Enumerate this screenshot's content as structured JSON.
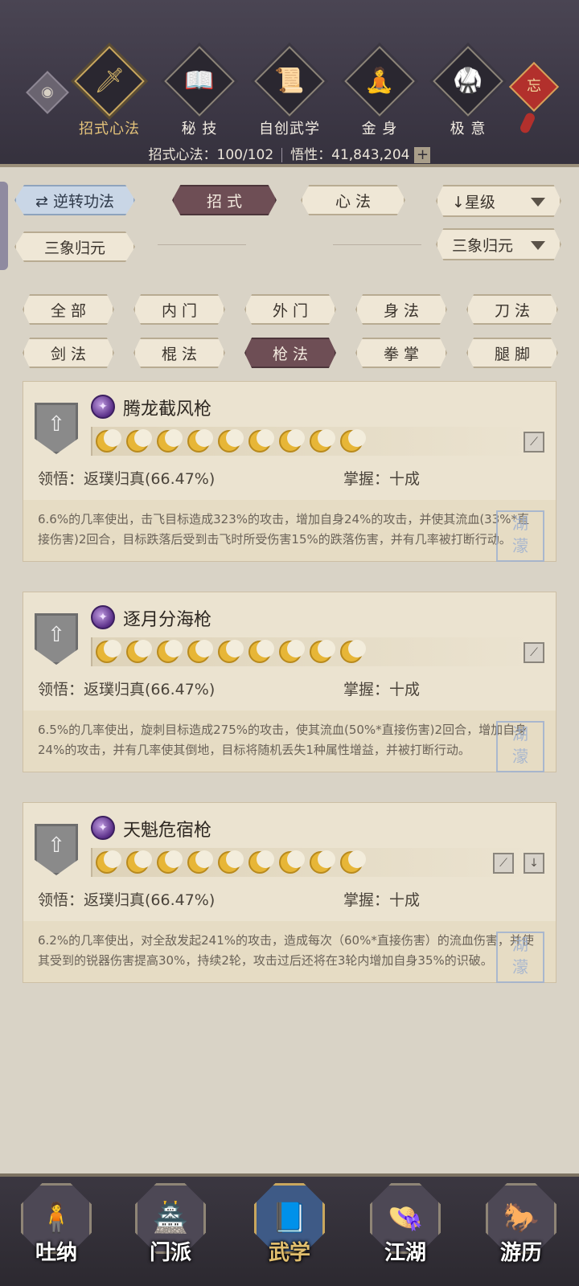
{
  "top_tabs": [
    {
      "label": "招式心法",
      "icon": "sword-icon",
      "glyph": "🗡"
    },
    {
      "label": "秘 技",
      "icon": "book-icon",
      "glyph": "📖"
    },
    {
      "label": "自创武学",
      "icon": "scroll-icon",
      "glyph": "📜"
    },
    {
      "label": "金 身",
      "icon": "meditation-icon",
      "glyph": "🧘"
    },
    {
      "label": "极 意",
      "icon": "martial-stance-icon",
      "glyph": "🥋"
    }
  ],
  "charm": {
    "label": "忘"
  },
  "stats": {
    "moves_label": "招式心法：100/102",
    "insight_label": "悟性：41,843,204",
    "plus": "+"
  },
  "controls": {
    "reverse": "逆转功法",
    "reverse_glyph": "⇄",
    "tab_moves": "招 式",
    "tab_heart": "心 法",
    "sort": "星级",
    "sort_glyph": "↓",
    "preset": "三象归元",
    "preset_dropdown": "三象归元"
  },
  "filters": [
    "全 部",
    "内 门",
    "外 门",
    "身 法",
    "刀 法",
    "剑 法",
    "棍 法",
    "枪 法",
    "拳 掌",
    "腿 脚"
  ],
  "active_filter": "枪 法",
  "skills": [
    {
      "name": "腾龙截风枪",
      "stars": 9,
      "comprehension": "领悟：返璞归真(66.47%)",
      "mastery": "掌握：十成",
      "description": "6.6%的几率使出，击飞目标造成323%的攻击，增加自身24%的攻击，并使其流血(33%*直接伤害)2回合，目标跌落后受到击飞时所受伤害15%的跌落伤害，并有几率被打断行动。",
      "icons": [
        "blade-slash-icon"
      ],
      "stamp": "湖濛"
    },
    {
      "name": "逐月分海枪",
      "stars": 9,
      "comprehension": "领悟：返璞归真(66.47%)",
      "mastery": "掌握：十成",
      "description": "6.5%的几率使出，旋刺目标造成275%的攻击，使其流血(50%*直接伤害)2回合，增加自身24%的攻击，并有几率使其倒地，目标将随机丢失1种属性增益，并被打断行动。",
      "icons": [
        "blade-slash-icon"
      ],
      "stamp": "湖濛"
    },
    {
      "name": "天魁危宿枪",
      "stars": 9,
      "comprehension": "领悟：返璞归真(66.47%)",
      "mastery": "掌握：十成",
      "description": "6.2%的几率使出，对全敌发起241%的攻击，造成每次（60%*直接伤害）的流血伤害，并使其受到的锐器伤害提高30%，持续2轮，攻击过后还将在3轮内增加自身35%的识破。",
      "icons": [
        "blade-slash-icon",
        "sword-down-icon"
      ],
      "stamp": "湖濛"
    }
  ],
  "bottom_nav": [
    {
      "label": "吐纳",
      "icon": "meditating-figure-icon",
      "glyph": "🧍"
    },
    {
      "label": "门派",
      "icon": "sect-banner-icon",
      "glyph": "🏯"
    },
    {
      "label": "武学",
      "icon": "martial-books-icon",
      "glyph": "📘"
    },
    {
      "label": "江湖",
      "icon": "straw-hat-icon",
      "glyph": "👒"
    },
    {
      "label": "游历",
      "icon": "horse-icon",
      "glyph": "🐎"
    }
  ],
  "active_bottom": "武学",
  "colors": {
    "header_bg": "#3d3846",
    "gold_accent": "#e3c27a",
    "active_pill": "#6e4e55",
    "blue_pill": "#c9d6e6",
    "card_bg": "#ebe3d0"
  }
}
